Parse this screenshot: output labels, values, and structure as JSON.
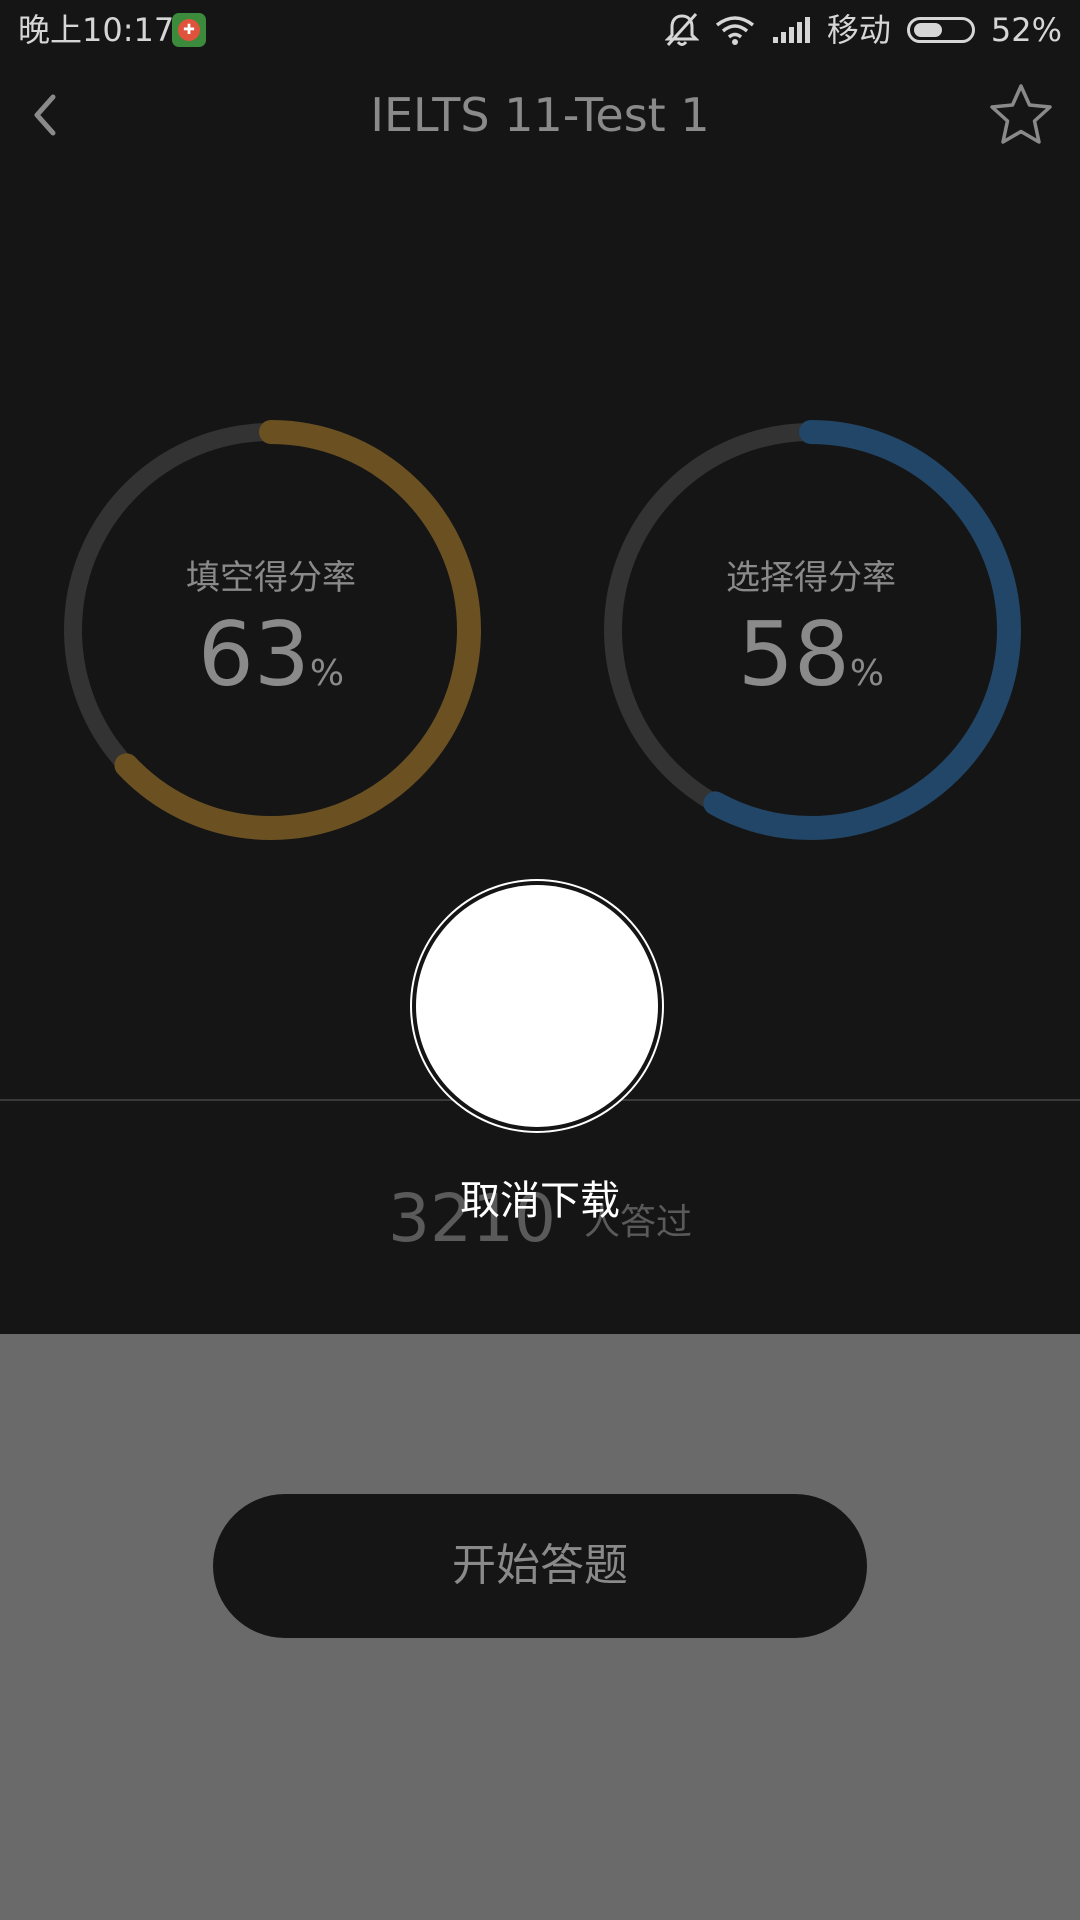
{
  "status_bar": {
    "time": "晚上10:17",
    "carrier": "移动",
    "battery_percent": "52%",
    "battery_level": 0.52,
    "icons": [
      "app-icon",
      "bell-muted-icon",
      "wifi-icon",
      "signal-icon",
      "battery-icon"
    ]
  },
  "header": {
    "title": "IELTS 11-Test 1",
    "back_icon": "chevron-left-icon",
    "star_icon": "star-outline-icon"
  },
  "scores": {
    "fill_blank": {
      "label": "填空得分率",
      "value": "63",
      "unit": "%",
      "fraction": 0.63,
      "color": "#6b5122"
    },
    "choice": {
      "label": "选择得分率",
      "value": "58",
      "unit": "%",
      "fraction": 0.58,
      "color": "#224667"
    },
    "track_color": "#333333"
  },
  "answered": {
    "count": "3210",
    "suffix": "人答过"
  },
  "overlay": {
    "cancel_label": "取消下载"
  },
  "actions": {
    "start_label": "开始答题"
  }
}
